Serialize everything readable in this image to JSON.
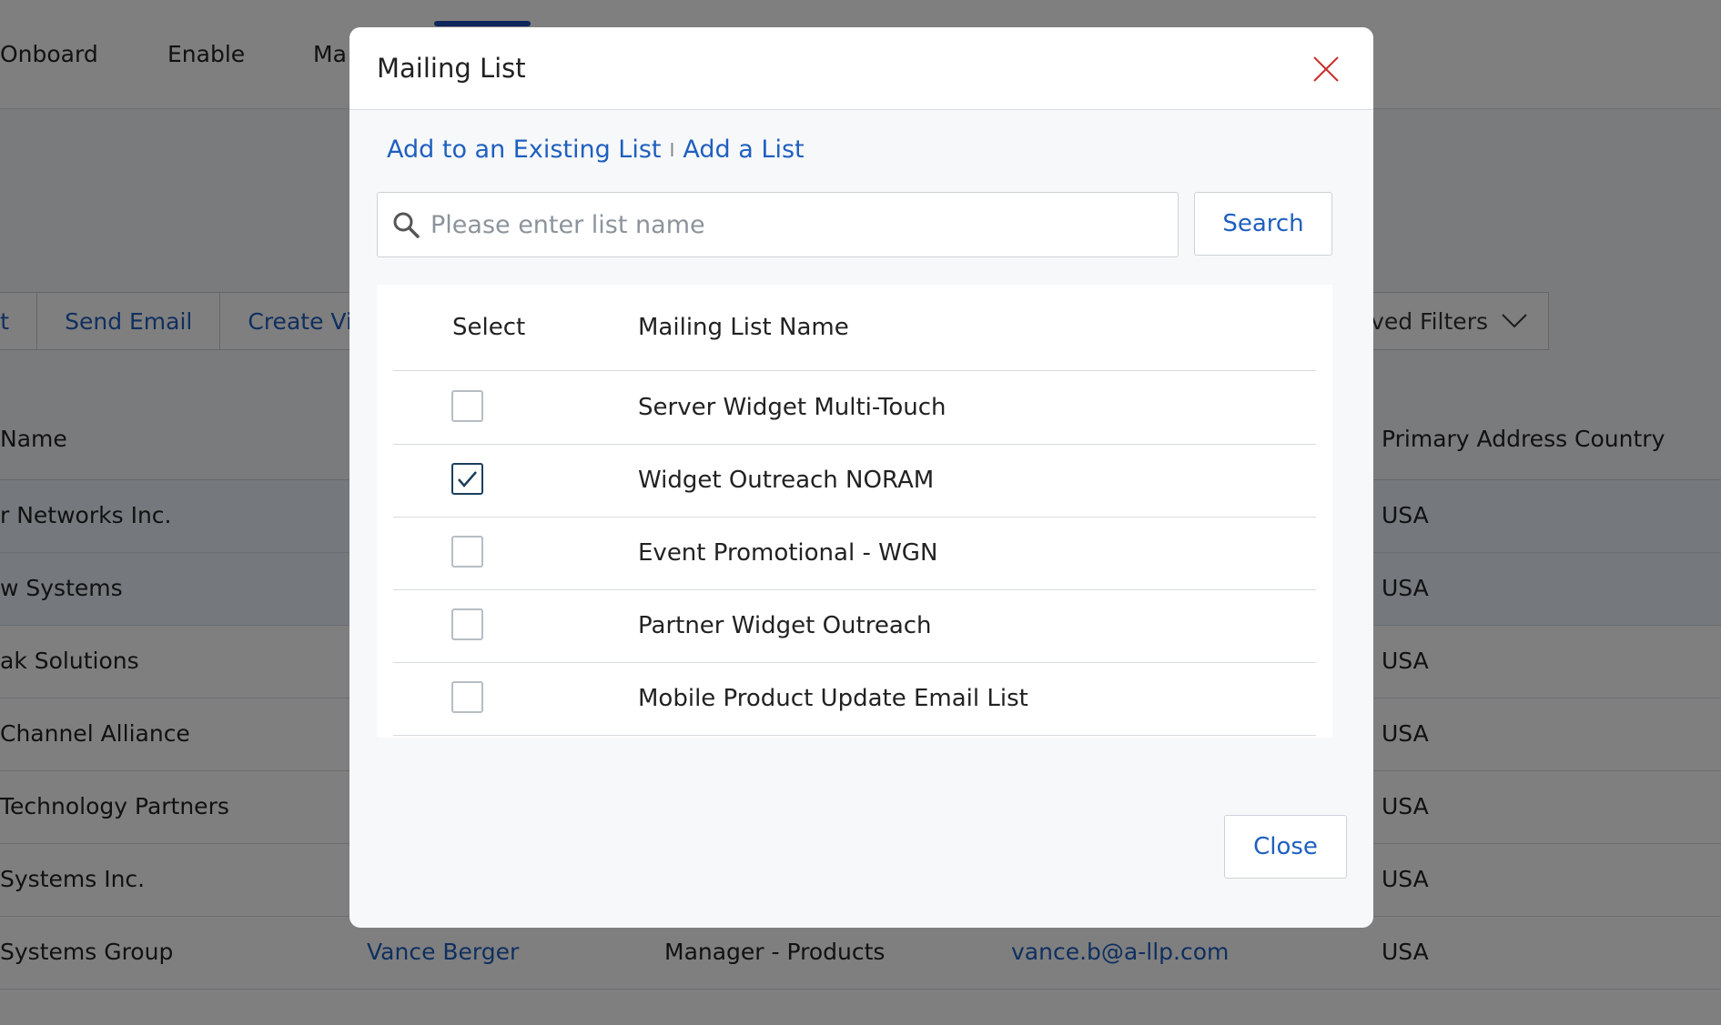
{
  "background": {
    "nav": [
      "Onboard",
      "Enable",
      "Ma"
    ],
    "toolbar": [
      "rt",
      "Send Email",
      "Create Vi"
    ],
    "saved_filters_label": "ved Filters",
    "table": {
      "headers": [
        "Name",
        "Primary Address Country"
      ],
      "rows": [
        {
          "name": "r Networks Inc.",
          "country": "USA"
        },
        {
          "name": "w Systems",
          "country": "USA"
        },
        {
          "name": "ak Solutions",
          "country": "USA"
        },
        {
          "name": "Channel Alliance",
          "country": "USA"
        },
        {
          "name": "Technology Partners",
          "country": "USA"
        },
        {
          "name": "Systems Inc.",
          "country": "USA"
        },
        {
          "name": "Systems Group",
          "contact": "Vance Berger",
          "title": "Manager - Products",
          "email": "vance.b@a-llp.com",
          "country": "USA"
        }
      ]
    }
  },
  "modal": {
    "title": "Mailing List",
    "links": {
      "existing": "Add to an Existing List",
      "separator": "I",
      "add": "Add a List"
    },
    "search": {
      "placeholder": "Please enter list name",
      "value": "",
      "button": "Search"
    },
    "columns": {
      "select": "Select",
      "name": "Mailing List Name"
    },
    "lists": [
      {
        "name": "Server Widget Multi-Touch",
        "checked": false
      },
      {
        "name": "Widget Outreach NORAM",
        "checked": true
      },
      {
        "name": "Event Promotional - WGN",
        "checked": false
      },
      {
        "name": "Partner Widget Outreach",
        "checked": false
      },
      {
        "name": "Mobile Product Update Email List",
        "checked": false
      }
    ],
    "close_label": "Close"
  },
  "icons": {
    "close": "close-icon",
    "search": "search-icon",
    "check": "checkmark-icon",
    "chevron": "chevron-down-icon"
  },
  "colors": {
    "link": "#1f5fbf",
    "close_x": "#c9302c",
    "nav_active": "#1d4fb8",
    "overlay": "rgba(0,0,0,0.5)"
  }
}
